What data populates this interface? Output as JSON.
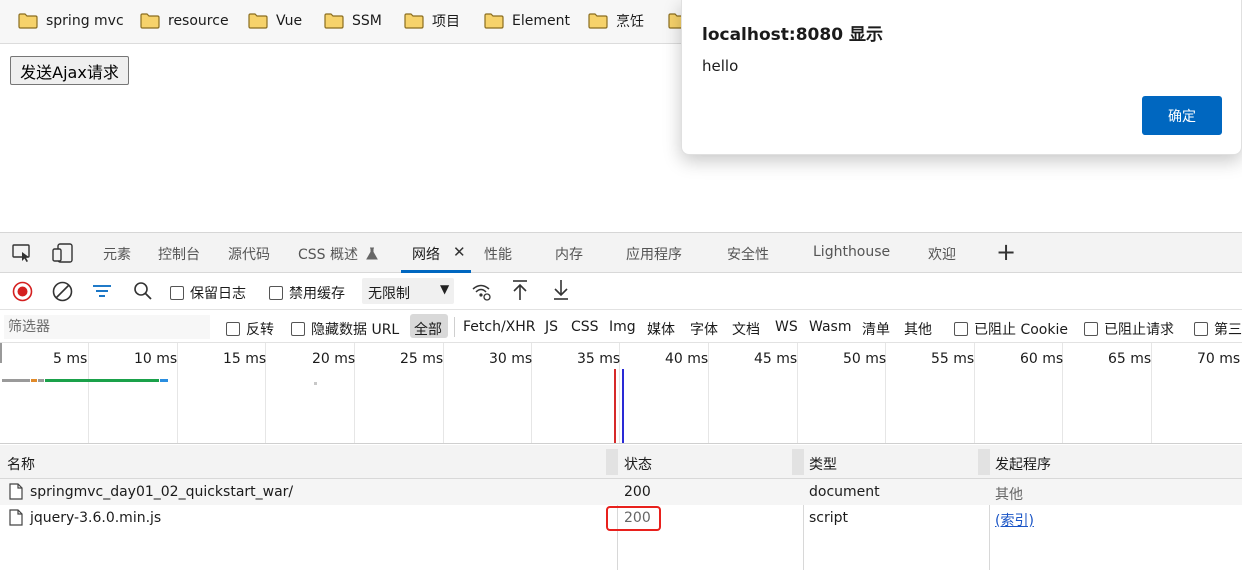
{
  "bookmarks": [
    {
      "label": "spring mvc",
      "icon": "folder-icon"
    },
    {
      "label": "resource",
      "icon": "folder-icon"
    },
    {
      "label": "Vue",
      "icon": "folder-icon"
    },
    {
      "label": "SSM",
      "icon": "folder-icon"
    },
    {
      "label": "项目",
      "icon": "folder-icon"
    },
    {
      "label": "Element",
      "icon": "folder-icon"
    },
    {
      "label": "烹饪",
      "icon": "folder-icon"
    }
  ],
  "page": {
    "ajax_button_label": "发送Ajax请求"
  },
  "dialog": {
    "title": "localhost:8080 显示",
    "message": "hello",
    "ok_label": "确定",
    "ok_color": "#0067c0"
  },
  "devtools": {
    "tabs": [
      {
        "label": "元素"
      },
      {
        "label": "控制台"
      },
      {
        "label": "源代码"
      },
      {
        "label": "CSS 概述"
      },
      {
        "label": "网络",
        "active": true
      },
      {
        "label": "性能"
      },
      {
        "label": "内存"
      },
      {
        "label": "应用程序"
      },
      {
        "label": "安全性"
      },
      {
        "label": "Lighthouse"
      },
      {
        "label": "欢迎"
      }
    ],
    "toolbar": {
      "preserve_log": "保留日志",
      "disable_cache": "禁用缓存",
      "throttling": "无限制"
    },
    "filter": {
      "placeholder": "筛选器",
      "invert": "反转",
      "hide_data_urls": "隐藏数据 URL",
      "types": [
        "全部",
        "Fetch/XHR",
        "JS",
        "CSS",
        "Img",
        "媒体",
        "字体",
        "文档",
        "WS",
        "Wasm",
        "清单",
        "其他"
      ],
      "blocked_cookies": "已阻止 Cookie",
      "blocked_requests": "已阻止请求",
      "third_party": "第三"
    },
    "timeline_labels": [
      "5 ms",
      "10 ms",
      "15 ms",
      "20 ms",
      "25 ms",
      "30 ms",
      "35 ms",
      "40 ms",
      "45 ms",
      "50 ms",
      "55 ms",
      "60 ms",
      "65 ms",
      "70 ms"
    ],
    "table": {
      "headers": [
        "名称",
        "状态",
        "类型",
        "发起程序"
      ],
      "rows": [
        {
          "name": "springmvc_day01_02_quickstart_war/",
          "status": "200",
          "type": "document",
          "initiator": "其他"
        },
        {
          "name": "jquery-3.6.0.min.js",
          "status": "200",
          "type": "script",
          "initiator": "(索引)"
        }
      ]
    },
    "highlight_color": "#e8201c"
  }
}
